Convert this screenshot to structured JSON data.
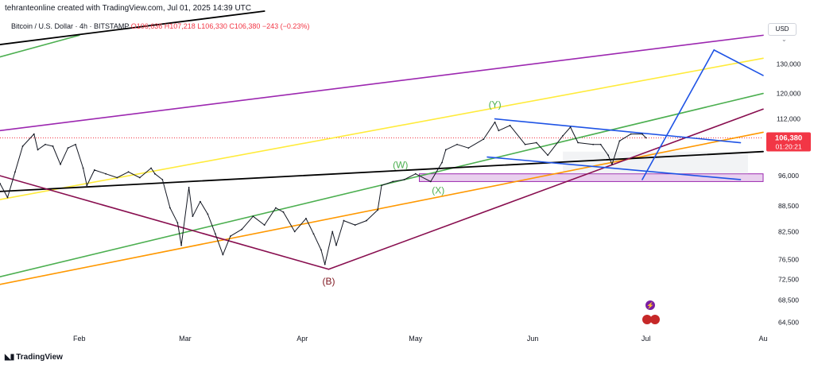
{
  "header": {
    "attribution": "tehranteonline created with TradingView.com, Jul 01, 2025 14:39 UTC"
  },
  "symbol_bar": {
    "name": "Bitcoin / U.S. Dollar · 4h · BITSTAMP",
    "ohlc": "O106,636 H107,218 L106,330 C106,380 −243 (−0.23%)"
  },
  "currency": "USD",
  "footer": {
    "brand": "TradingView"
  },
  "colors": {
    "price_line": "#131722",
    "purple": "#9c27b0",
    "yellow": "#ffeb3b",
    "green": "#4caf50",
    "maroon": "#880e4f",
    "orange": "#ff9800",
    "blue": "#1e53e5",
    "black": "#000000",
    "label_red": "#f23645",
    "wave_green": "#4caf50",
    "wave_b": "#801922"
  },
  "chart_data": {
    "type": "line",
    "title": "Bitcoin / U.S. Dollar · 4h · BITSTAMP",
    "xlabel": "",
    "ylabel": "",
    "y_scale": "log",
    "ylim": [
      62000,
      150000
    ],
    "x_range": [
      "2025-01-11",
      "2025-08-01"
    ],
    "y_ticks": [
      64500,
      68500,
      72500,
      76500,
      82500,
      88500,
      96000,
      112000,
      120000,
      130000
    ],
    "y_tick_labels": [
      "64,500",
      "68,500",
      "72,500",
      "76,500",
      "82,500",
      "88,500",
      "96,000",
      "112,000",
      "120,000",
      "130,000"
    ],
    "x_ticks": [
      {
        "date": "2025-02-01",
        "label": "Feb"
      },
      {
        "date": "2025-03-01",
        "label": "Mar"
      },
      {
        "date": "2025-04-01",
        "label": "Apr"
      },
      {
        "date": "2025-05-01",
        "label": "May"
      },
      {
        "date": "2025-06-01",
        "label": "Jun"
      },
      {
        "date": "2025-07-01",
        "label": "Jul"
      },
      {
        "date": "2025-08-01",
        "label": "Au"
      }
    ],
    "price_series": {
      "name": "BTCUSD",
      "points": [
        [
          "2025-01-11",
          94000
        ],
        [
          "2025-01-13",
          90500
        ],
        [
          "2025-01-15",
          97000
        ],
        [
          "2025-01-17",
          104000
        ],
        [
          "2025-01-20",
          107500
        ],
        [
          "2025-01-21",
          103000
        ],
        [
          "2025-01-23",
          104500
        ],
        [
          "2025-01-25",
          104000
        ],
        [
          "2025-01-27",
          99000
        ],
        [
          "2025-01-29",
          103500
        ],
        [
          "2025-01-31",
          104500
        ],
        [
          "2025-02-02",
          98000
        ],
        [
          "2025-02-03",
          93500
        ],
        [
          "2025-02-05",
          97500
        ],
        [
          "2025-02-08",
          96500
        ],
        [
          "2025-02-11",
          95500
        ],
        [
          "2025-02-14",
          97000
        ],
        [
          "2025-02-17",
          95500
        ],
        [
          "2025-02-20",
          98000
        ],
        [
          "2025-02-21",
          96500
        ],
        [
          "2025-02-23",
          95000
        ],
        [
          "2025-02-25",
          88000
        ],
        [
          "2025-02-27",
          84500
        ],
        [
          "2025-02-28",
          79500
        ],
        [
          "2025-03-02",
          93000
        ],
        [
          "2025-03-03",
          86000
        ],
        [
          "2025-03-05",
          89500
        ],
        [
          "2025-03-07",
          86500
        ],
        [
          "2025-03-09",
          82000
        ],
        [
          "2025-03-11",
          77500
        ],
        [
          "2025-03-13",
          81500
        ],
        [
          "2025-03-16",
          83000
        ],
        [
          "2025-03-19",
          86000
        ],
        [
          "2025-03-22",
          84000
        ],
        [
          "2025-03-25",
          88000
        ],
        [
          "2025-03-27",
          87000
        ],
        [
          "2025-03-30",
          82500
        ],
        [
          "2025-04-02",
          85500
        ],
        [
          "2025-04-04",
          82000
        ],
        [
          "2025-04-06",
          78500
        ],
        [
          "2025-04-07",
          75500
        ],
        [
          "2025-04-09",
          82500
        ],
        [
          "2025-04-10",
          79500
        ],
        [
          "2025-04-12",
          85000
        ],
        [
          "2025-04-15",
          84000
        ],
        [
          "2025-04-18",
          85000
        ],
        [
          "2025-04-21",
          87500
        ],
        [
          "2025-04-22",
          93500
        ],
        [
          "2025-04-25",
          94500
        ],
        [
          "2025-04-28",
          95000
        ],
        [
          "2025-05-01",
          96500
        ],
        [
          "2025-05-05",
          94500
        ],
        [
          "2025-05-08",
          99500
        ],
        [
          "2025-05-09",
          103000
        ],
        [
          "2025-05-12",
          104500
        ],
        [
          "2025-05-15",
          103500
        ],
        [
          "2025-05-19",
          106000
        ],
        [
          "2025-05-22",
          111000
        ],
        [
          "2025-05-23",
          108500
        ],
        [
          "2025-05-26",
          110000
        ],
        [
          "2025-05-30",
          104500
        ],
        [
          "2025-06-02",
          105000
        ],
        [
          "2025-06-05",
          101500
        ],
        [
          "2025-06-09",
          107000
        ],
        [
          "2025-06-11",
          109500
        ],
        [
          "2025-06-13",
          105000
        ],
        [
          "2025-06-17",
          104500
        ],
        [
          "2025-06-19",
          104500
        ],
        [
          "2025-06-21",
          101500
        ],
        [
          "2025-06-22",
          99000
        ],
        [
          "2025-06-24",
          105500
        ],
        [
          "2025-06-27",
          107500
        ],
        [
          "2025-06-30",
          107500
        ],
        [
          "2025-07-01",
          106380
        ]
      ]
    },
    "current_price": {
      "label": "106,380",
      "value": 106380,
      "countdown": "01:20:21",
      "color": "#f23645"
    },
    "reference_level": {
      "value": 106380,
      "style": "dotted",
      "color": "#f23645"
    },
    "trendlines": [
      {
        "name": "purple-channel-line",
        "color": "#9c27b0",
        "from": [
          "2025-01-11",
          108500
        ],
        "to": [
          "2025-08-01",
          140500
        ]
      },
      {
        "name": "yellow-channel-line",
        "color": "#ffeb3b",
        "from": [
          "2025-01-11",
          90000
        ],
        "to": [
          "2025-08-01",
          132000
        ]
      },
      {
        "name": "green-channel-line",
        "color": "#4caf50",
        "from": [
          "2025-01-11",
          73000
        ],
        "to": [
          "2025-08-01",
          120000
        ]
      },
      {
        "name": "orange-channel-line",
        "color": "#ff9800",
        "from": [
          "2025-01-11",
          71500
        ],
        "to": [
          "2025-08-01",
          108000
        ]
      },
      {
        "name": "green-top-channel-line",
        "color": "#4caf50",
        "from": [
          "2025-01-11",
          132500
        ],
        "to": [
          "2025-02-01",
          140500
        ]
      },
      {
        "name": "black-top-line",
        "color": "#000000",
        "from": [
          "2025-01-11",
          137000
        ],
        "to": [
          "2025-03-22",
          150000
        ]
      },
      {
        "name": "black-support-line",
        "color": "#000000",
        "from": [
          "2025-01-11",
          92000
        ],
        "to": [
          "2025-08-01",
          102500
        ]
      },
      {
        "name": "maroon-down-line",
        "color": "#880e4f",
        "from": [
          "2025-01-11",
          96000
        ],
        "to": [
          "2025-04-08",
          74500
        ]
      },
      {
        "name": "maroon-up-line",
        "color": "#880e4f",
        "from": [
          "2025-04-08",
          74500
        ],
        "to": [
          "2025-08-01",
          115000
        ]
      },
      {
        "name": "blue-upper-wedge",
        "color": "#1e53e5",
        "from": [
          "2025-05-22",
          112000
        ],
        "to": [
          "2025-07-26",
          105000
        ]
      },
      {
        "name": "blue-lower-wedge",
        "color": "#1e53e5",
        "from": [
          "2025-05-20",
          101000
        ],
        "to": [
          "2025-07-26",
          95000
        ]
      },
      {
        "name": "blue-projection-up",
        "color": "#1e53e5",
        "from": [
          "2025-06-30",
          95000
        ],
        "to": [
          "2025-07-19",
          135000
        ]
      },
      {
        "name": "blue-projection-down",
        "color": "#1e53e5",
        "from": [
          "2025-07-19",
          135000
        ],
        "to": [
          "2025-08-01",
          126000
        ]
      }
    ],
    "zones": [
      {
        "name": "purple-support-zone",
        "color": "#9c27b0",
        "from_date": "2025-05-02",
        "to_date": "2025-08-01",
        "y0": 94500,
        "y1": 96500
      },
      {
        "name": "grey-range-zone",
        "color": "#d1d4dc",
        "from_date": "2025-06-09",
        "to_date": "2025-07-28",
        "y0": 96500,
        "y1": 102500
      }
    ],
    "annotations": [
      {
        "text": "(Y)",
        "date": "2025-05-22",
        "price": 115500,
        "color": "#4caf50"
      },
      {
        "text": "(W)",
        "date": "2025-04-27",
        "price": 98000,
        "color": "#4caf50"
      },
      {
        "text": "(X)",
        "date": "2025-05-07",
        "price": 91500,
        "color": "#4caf50"
      },
      {
        "text": "(B)",
        "date": "2025-04-08",
        "price": 71500,
        "color": "#801922"
      }
    ]
  }
}
